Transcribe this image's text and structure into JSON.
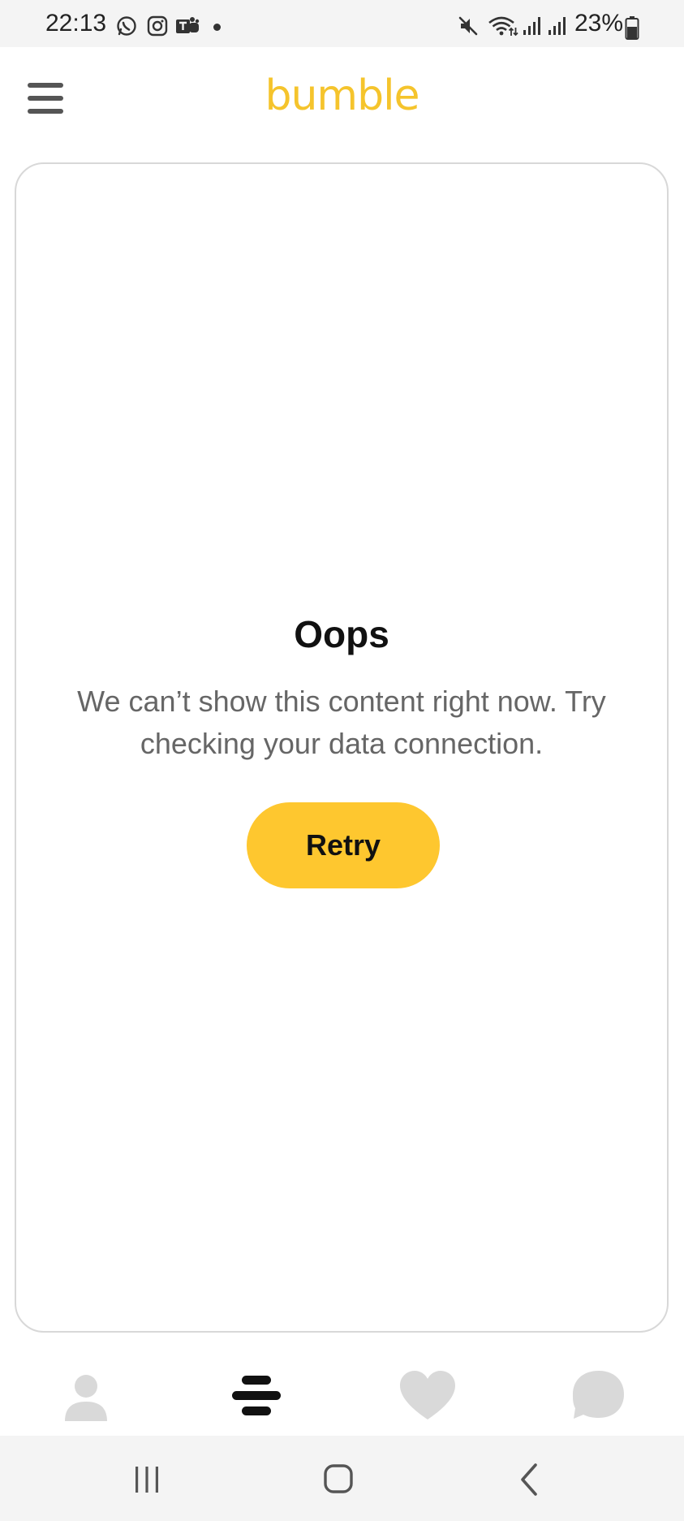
{
  "status_bar": {
    "time": "22:13",
    "battery": "23%",
    "notification_icons": [
      "whatsapp-icon",
      "instagram-icon",
      "teams-icon"
    ],
    "system_icons": [
      "mute-icon",
      "wifi-icon",
      "signal-icon",
      "signal-icon",
      "battery-icon"
    ]
  },
  "header": {
    "logo": "bumble",
    "menu_icon": "hamburger-menu-icon"
  },
  "error_card": {
    "title": "Oops",
    "message": "We can’t show this content right now. Try checking your data connection.",
    "retry_label": "Retry"
  },
  "tab_bar": {
    "tabs": [
      {
        "icon": "profile-icon",
        "active": false
      },
      {
        "icon": "bumble-swipe-icon",
        "active": true
      },
      {
        "icon": "heart-icon",
        "active": false
      },
      {
        "icon": "chat-icon",
        "active": false
      }
    ]
  },
  "nav_bar": {
    "buttons": [
      "recent-apps-icon",
      "home-icon",
      "back-icon"
    ]
  },
  "colors": {
    "brand_yellow": "#fec72f",
    "logo_yellow": "#f5c42c",
    "inactive_icon": "#d9d9d9",
    "active_icon": "#111111"
  }
}
